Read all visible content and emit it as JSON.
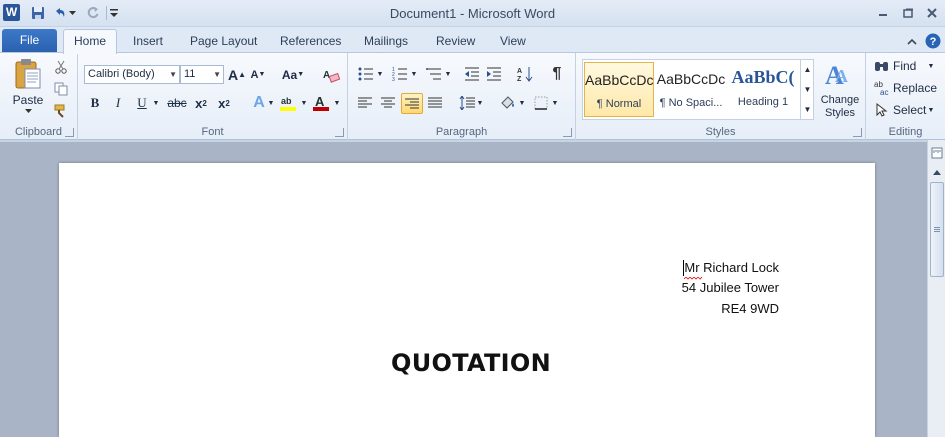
{
  "window": {
    "title": "Document1  -  Microsoft Word",
    "app_icon": "W"
  },
  "tabs": {
    "file": "File",
    "home": "Home",
    "insert": "Insert",
    "page_layout": "Page Layout",
    "references": "References",
    "mailings": "Mailings",
    "review": "Review",
    "view": "View"
  },
  "ribbon": {
    "clipboard": {
      "paste": "Paste",
      "label": "Clipboard"
    },
    "font": {
      "family": "Calibri (Body)",
      "size": "11",
      "label": "Font",
      "font_color": "#c00000",
      "highlight_color": "#ffff00"
    },
    "paragraph": {
      "label": "Paragraph",
      "pilcrow": "¶"
    },
    "styles": {
      "label": "Styles",
      "items": [
        {
          "preview": "AaBbCcDc",
          "name": "¶ Normal"
        },
        {
          "preview": "AaBbCcDc",
          "name": "¶ No Spaci..."
        },
        {
          "preview": "AaBbC(",
          "name": "Heading 1"
        }
      ],
      "change_styles": "Change Styles"
    },
    "editing": {
      "label": "Editing",
      "find": "Find",
      "replace": "Replace",
      "select": "Select"
    }
  },
  "document": {
    "address_lines": [
      "Mr Richard Lock",
      "54 Jubilee Tower",
      "RE4 9WD"
    ],
    "heading": "QUOTATION"
  }
}
